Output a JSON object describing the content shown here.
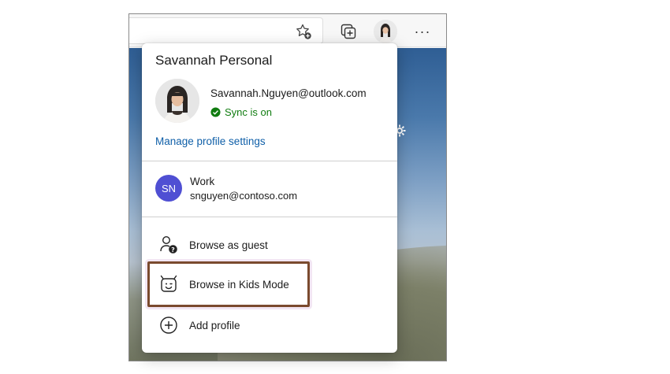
{
  "toolbar": {
    "favorites_icon": "star-add-icon",
    "collections_icon": "collections-icon",
    "profile_icon": "avatar",
    "more_label": "···"
  },
  "profile": {
    "name": "Savannah Personal",
    "email": "Savannah.Nguyen@outlook.com",
    "sync_status": "Sync is on",
    "manage_link": "Manage profile settings"
  },
  "other_profile": {
    "initials": "SN",
    "name": "Work",
    "email": "snguyen@contoso.com",
    "badge_color": "#4f4fd3"
  },
  "menu": {
    "guest_label": "Browse as guest",
    "kids_label": "Browse in Kids Mode",
    "add_label": "Add profile"
  },
  "colors": {
    "link": "#0f5fa8",
    "sync": "#107c10",
    "highlight": "#7a4a2e"
  }
}
